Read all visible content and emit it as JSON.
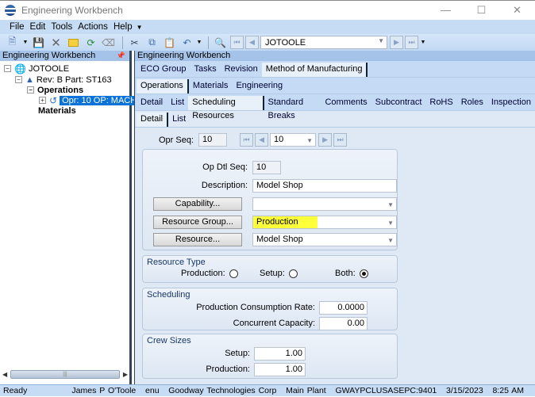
{
  "window": {
    "title": "Engineering Workbench",
    "controls": [
      "minimize",
      "maximize",
      "close"
    ]
  },
  "menu": {
    "items": [
      "File",
      "Edit",
      "Tools",
      "Actions",
      "Help"
    ]
  },
  "toolbar": {
    "icons": [
      "new-icon",
      "save-icon",
      "delete-icon",
      "clear-icon",
      "refresh-icon",
      "eraser-icon",
      "cut-icon",
      "copy-icon",
      "paste-icon",
      "undo-icon",
      "search-icon"
    ],
    "record_value": "JOTOOLE"
  },
  "left_panel": {
    "header": "Engineering Workbench",
    "tree": [
      {
        "label": "JOTOOLE",
        "level": 0,
        "expanded": true
      },
      {
        "label": "Rev: B Part: ST163",
        "level": 1,
        "expanded": true
      },
      {
        "label": "Operations",
        "level": 2,
        "bold": true,
        "expanded": true
      },
      {
        "label": "Opr: 10 OP: MACH",
        "level": 3,
        "selected": true,
        "expanded": false
      },
      {
        "label": "Materials",
        "level": 2,
        "bold": true
      }
    ]
  },
  "main_panel": {
    "header": "Engineering Workbench",
    "tabs1": [
      "ECO Group",
      "Tasks",
      "Revision",
      "Method of Manufacturing"
    ],
    "tabs1_active": "Method of Manufacturing",
    "tabs2": [
      "Operations",
      "Materials",
      "Engineering"
    ],
    "tabs2_active": "Operations",
    "tabs3": [
      "Detail",
      "List",
      "Scheduling Resources",
      "Standard Breaks",
      "Comments",
      "Subcontract",
      "RoHS",
      "Roles",
      "Inspection"
    ],
    "tabs3_active": "Scheduling Resources",
    "tabs4": [
      "Detail",
      "List"
    ],
    "tabs4_active": "Detail"
  },
  "form": {
    "opr_seq_label": "Opr Seq:",
    "opr_seq_value": "10",
    "opr_seq_nav_value": "10",
    "op_dtl_seq_label": "Op Dtl Seq:",
    "op_dtl_seq_value": "10",
    "description_label": "Description:",
    "description_value": "Model Shop",
    "capability_button": "Capability...",
    "capability_value": "",
    "resource_group_button": "Resource Group...",
    "resource_group_value": "Production",
    "resource_button": "Resource...",
    "resource_value": "Model Shop",
    "resource_type": {
      "title": "Resource Type",
      "options": [
        "Production:",
        "Setup:",
        "Both:"
      ],
      "selected": "Both:"
    },
    "scheduling": {
      "title": "Scheduling",
      "prod_consumption_rate_label": "Production Consumption Rate:",
      "prod_consumption_rate_value": "0.0000",
      "concurrent_capacity_label": "Concurrent Capacity:",
      "concurrent_capacity_value": "0.00"
    },
    "crew_sizes": {
      "title": "Crew Sizes",
      "setup_label": "Setup:",
      "setup_value": "1.00",
      "production_label": "Production:",
      "production_value": "1.00"
    }
  },
  "status": {
    "state": "Ready",
    "info": "James P O'Toole   enu   Goodway Technologies Corp   Main Plant   GWAYPCLUSASEPC:9401   3/15/2023   8:25 AM"
  },
  "colors": {
    "highlight": "#ffff3a",
    "selection": "#0a72d8",
    "chrome": "#c6dcf5"
  }
}
